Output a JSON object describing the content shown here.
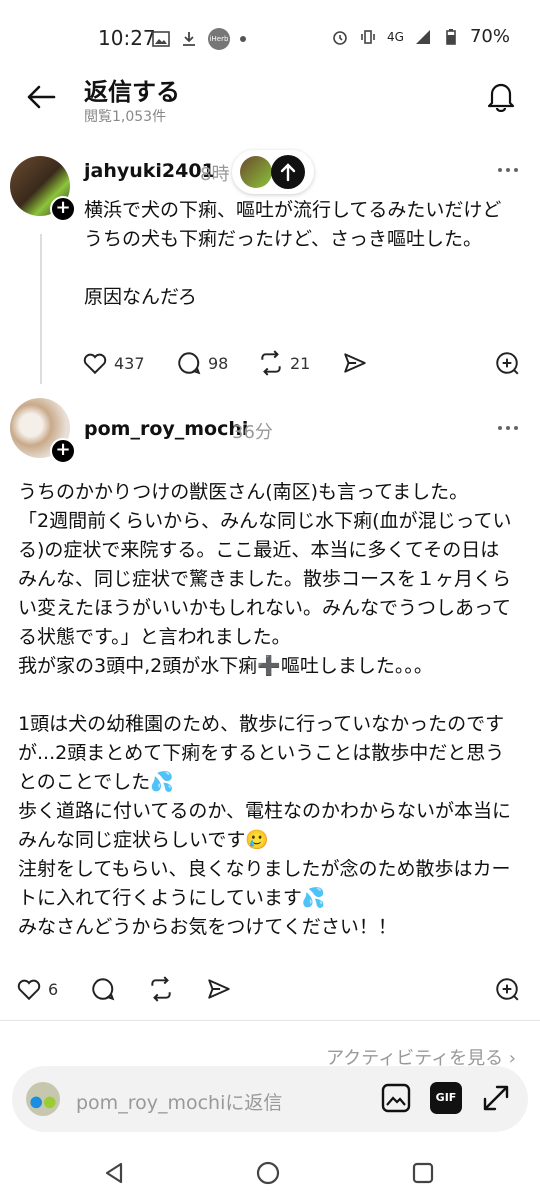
{
  "status_bar": {
    "time": "10:27",
    "iherb": "iHerb",
    "network": "4G",
    "battery": "70%"
  },
  "header": {
    "title": "返信する",
    "views": "閲覧1,053件"
  },
  "original_post": {
    "username": "jahyuki2401",
    "time": "8時",
    "text": "横浜で犬の下痢、嘔吐が流行してるみたいだけど\nうちの犬も下痢だったけど、さっき嘔吐した。\n\n原因なんだろ",
    "likes": "437",
    "comments": "98",
    "reposts": "21"
  },
  "reply_post": {
    "username": "pom_roy_mochi",
    "time": "36分",
    "text": "うちのかかりつけの獣医さん(南区)も言ってました。\n「2週間前くらいから、みんな同じ水下痢(血が混じっている)の症状で来院する。ここ最近、本当に多くてその日はみんな、同じ症状で驚きました。散歩コースを１ヶ月くらい変えたほうがいいかもしれない。みんなでうつしあってる状態です。」と言われました。\n我が家の3頭中,2頭が水下痢➕嘔吐しました。。。\n\n1頭は犬の幼稚園のため、散歩に行っていなかったのですが...2頭まとめて下痢をするということは散歩中だと思うとのことでした💦\n歩く道路に付いてるのか、電柱なのかわからないが本当にみんな同じ症状らしいです🥲\n注射をしてもらい、良くなりましたが念のため散歩はカートに入れて行くようにしています💦\nみなさんどうからお気をつけてください！！",
    "likes": "6"
  },
  "activity_link": "アクティビティを見る ›",
  "reply_input": {
    "placeholder": "pom_roy_mochiに返信"
  },
  "gif_label": "GIF",
  "colors": {
    "accent": "#000000",
    "muted": "#999999",
    "background": "#ffffff",
    "input_bg": "#f2f2f2"
  }
}
